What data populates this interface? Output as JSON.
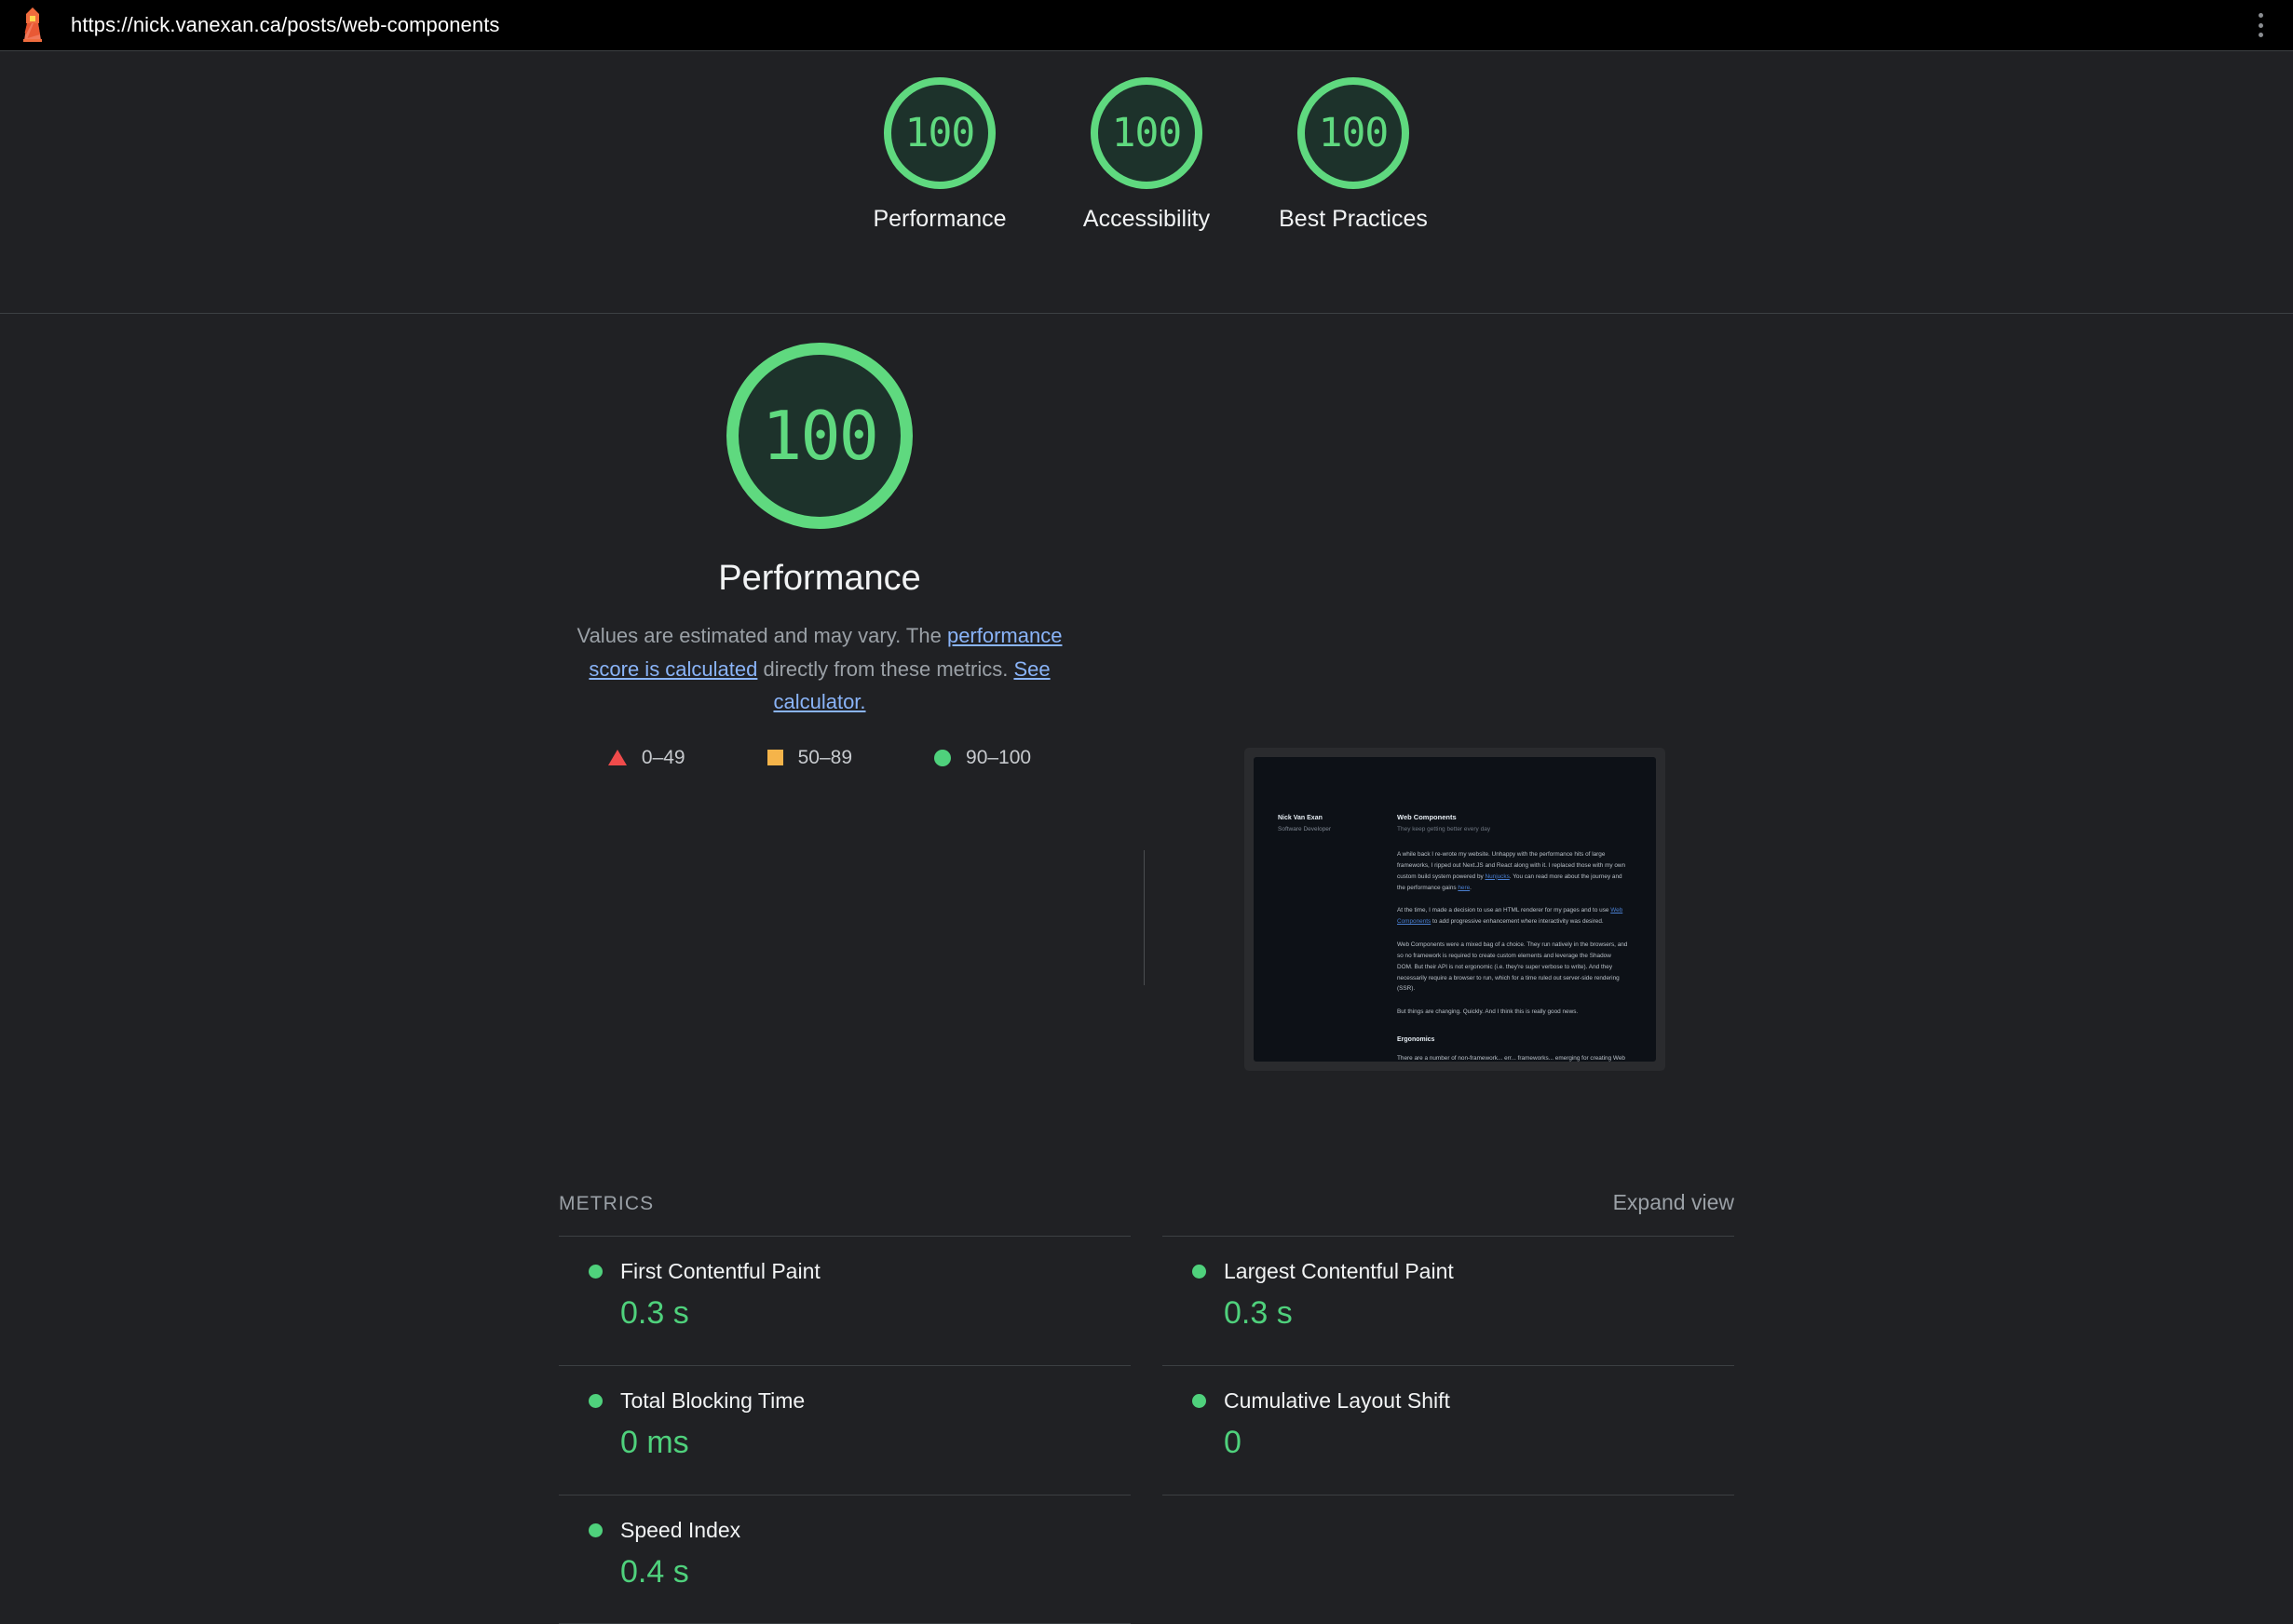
{
  "topbar": {
    "url": "https://nick.vanexan.ca/posts/web-components",
    "logo_name": "lighthouse-logo",
    "menu_name": "more-options"
  },
  "category_scores": [
    {
      "score": "100",
      "label": "Performance"
    },
    {
      "score": "100",
      "label": "Accessibility"
    },
    {
      "score": "100",
      "label": "Best Practices"
    }
  ],
  "hero": {
    "score": "100",
    "title": "Performance",
    "desc_part1": "Values are estimated and may vary. The ",
    "link1": "performance score is calculated",
    "desc_part2": " directly from these metrics. ",
    "link2": "See calculator."
  },
  "legend": [
    {
      "shape": "triangle",
      "range": "0–49"
    },
    {
      "shape": "square",
      "range": "50–89"
    },
    {
      "shape": "circle",
      "range": "90–100"
    }
  ],
  "metrics_section": {
    "title": "METRICS",
    "expand_label": "Expand view"
  },
  "metrics": [
    {
      "name": "First Contentful Paint",
      "value": "0.3 s",
      "status": "pass"
    },
    {
      "name": "Largest Contentful Paint",
      "value": "0.3 s",
      "status": "pass"
    },
    {
      "name": "Total Blocking Time",
      "value": "0 ms",
      "status": "pass"
    },
    {
      "name": "Cumulative Layout Shift",
      "value": "0",
      "status": "pass"
    },
    {
      "name": "Speed Index",
      "value": "0.4 s",
      "status": "pass"
    }
  ],
  "thumbnail": {
    "author": "Nick Van Exan",
    "role": "Software Developer",
    "heading": "Web Components",
    "subheading": "They keep getting better every day",
    "p1a": "A while back I re-wrote my website. Unhappy with the performance hits of large frameworks, I ripped out Next.JS and React along with it. I replaced those with my own custom build system powered by ",
    "p1link": "Nunjucks",
    "p1b": ". You can read more about the journey and the performance gains ",
    "p1link2": "here",
    "p1c": ".",
    "p2a": "At the time, I made a decision to use an HTML renderer for my pages and to use ",
    "p2link": "Web Components",
    "p2b": " to add progressive enhancement where interactivity was desired.",
    "p3": "Web Components were a mixed bag of a choice. They run natively in the browsers, and so no framework is required to create custom elements and leverage the Shadow DOM. But their API is not ergonomic (i.e. they're super verbose to write). And they necessarily require a browser to run, which for a time ruled out server-side rendering (SSR).",
    "p4": "But things are changing. Quickly. And I think this is really good news.",
    "h2": "Ergonomics",
    "p5": "There are a number of non-framework... err... frameworks... emerging for creating Web Components, which improve the ergonomics of writing custom elements. I'll briefly mention my favourites."
  },
  "colors": {
    "pass_green": "#4fd17c",
    "ring_green": "#5fd97f",
    "average_orange": "#f5b44a",
    "fail_red": "#f04b4b",
    "link_blue": "#8ab4f8",
    "background": "#202124"
  }
}
